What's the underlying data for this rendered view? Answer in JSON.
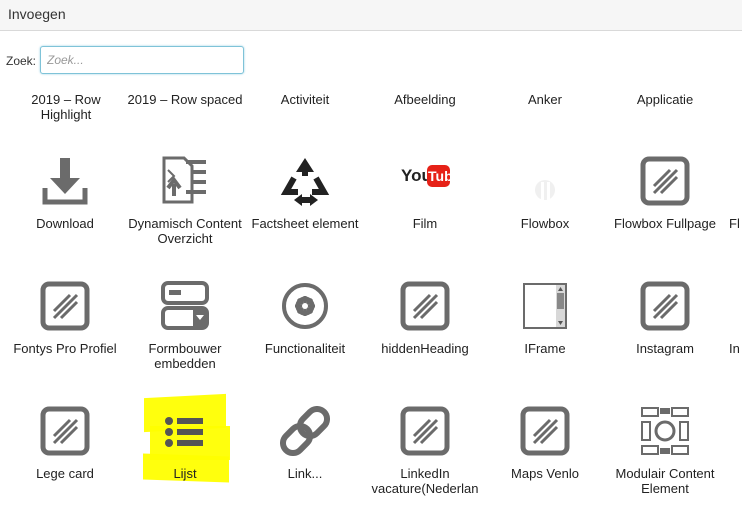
{
  "dialog": {
    "title": "Invoegen"
  },
  "search": {
    "label": "Zoek:",
    "placeholder": "Zoek..."
  },
  "rows": [
    [
      "2019 – Row Highlight",
      "2019 – Row spaced",
      "Activiteit",
      "Afbeelding",
      "Anker",
      "Applicatie"
    ],
    [
      "Download",
      "Dynamisch Content Overzicht",
      "Factsheet element",
      "Film",
      "Flowbox",
      "Flowbox Fullpage",
      "Fl"
    ],
    [
      "Fontys Pro Profiel",
      "Formbouwer embedden",
      "Functionaliteit",
      "hiddenHeading",
      "IFrame",
      "Instagram",
      "In"
    ],
    [
      "Lege card",
      "Lijst",
      "Link...",
      "LinkedIn vacature(Nederlan",
      "Maps Venlo",
      "Modulair Content Element"
    ]
  ],
  "icons": {
    "youtube_text": "You",
    "youtube_tube": "Tub"
  },
  "colors": {
    "icon_gray": "#6b6b6b",
    "highlight": "#ffff00",
    "youtube_red": "#e62117"
  }
}
